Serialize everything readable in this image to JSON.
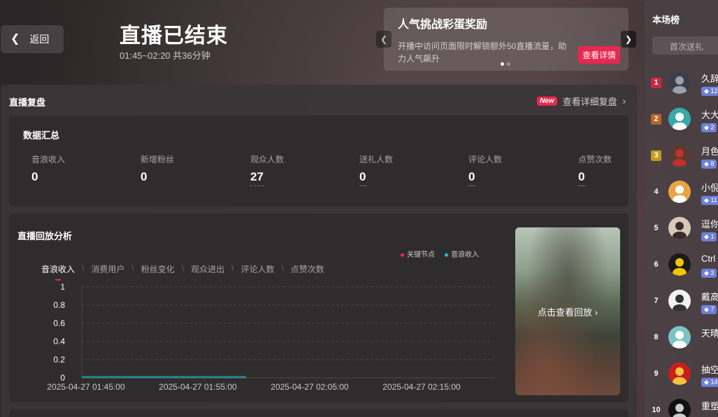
{
  "header": {
    "back_label": "返回",
    "title": "直播已结束",
    "time_range": "01:45~02:20 共36分钟"
  },
  "promo": {
    "title": "人气挑战彩蛋奖励",
    "description": "开播中访问页面限时解锁额外50直播流量，助力人气飙升",
    "button": "查看详情"
  },
  "review": {
    "title": "直播复盘",
    "new_badge": "New",
    "detail_link": "查看详细复盘"
  },
  "summary": {
    "title": "数据汇总",
    "metrics": [
      {
        "label": "音浪收入",
        "value": "0"
      },
      {
        "label": "新增粉丝",
        "value": "0"
      },
      {
        "label": "观众人数",
        "value": "27"
      },
      {
        "label": "送礼人数",
        "value": "0"
      },
      {
        "label": "评论人数",
        "value": "0"
      },
      {
        "label": "点赞次数",
        "value": "0"
      }
    ]
  },
  "analysis": {
    "title": "直播回放分析",
    "legend": [
      {
        "name": "关键节点",
        "color": "#e8284f"
      },
      {
        "name": "音浪收入",
        "color": "#21c4cf"
      }
    ],
    "tabs": [
      "音浪收入",
      "消费用户",
      "粉丝变化",
      "观众进出",
      "评论人数",
      "点赞次数"
    ],
    "replay_label": "点击查看回放"
  },
  "chart_data": {
    "type": "line",
    "x_ticks": [
      "2025-04-27 01:45:00",
      "2025-04-27 01:55:00",
      "2025-04-27 02:05:00",
      "2025-04-27 02:15:00"
    ],
    "y_ticks": [
      "0",
      "0.2",
      "0.4",
      "0.6",
      "0.8",
      "1"
    ],
    "ylim": [
      0,
      1
    ],
    "series": [
      {
        "name": "音浪收入",
        "values": [
          0,
          0,
          0,
          0,
          0,
          0,
          0,
          0
        ]
      }
    ],
    "grid": true
  },
  "leaderboard": {
    "title": "本场榜",
    "tab": "首次送礼",
    "entries": [
      {
        "rank": "1",
        "name": "久辞",
        "badge": "12"
      },
      {
        "rank": "2",
        "name": "大大",
        "badge": "2"
      },
      {
        "rank": "3",
        "name": "月色",
        "badge": "8"
      },
      {
        "rank": "4",
        "name": "小倪",
        "badge": "11"
      },
      {
        "rank": "5",
        "name": "逗你",
        "badge": "1"
      },
      {
        "rank": "6",
        "name": "Ctrl",
        "badge": "3"
      },
      {
        "rank": "7",
        "name": "戴高",
        "badge": "7"
      },
      {
        "rank": "8",
        "name": "天晴",
        "badge": ""
      },
      {
        "rank": "9",
        "name": "抽空",
        "badge": "14"
      },
      {
        "rank": "10",
        "name": "重塑",
        "badge": ""
      }
    ]
  }
}
